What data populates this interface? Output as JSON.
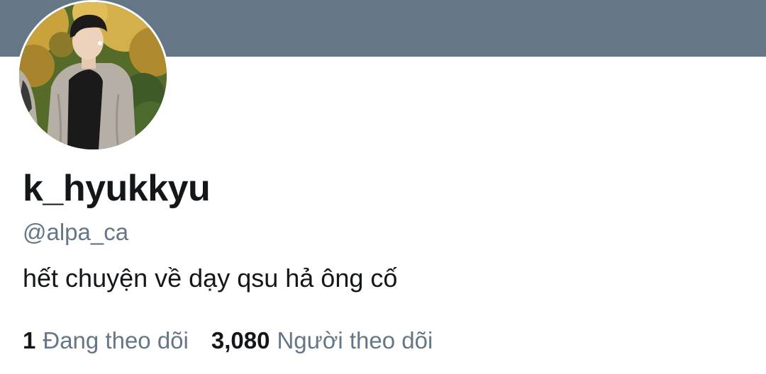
{
  "profile": {
    "display_name": "k_hyukkyu",
    "handle": "@alpa_ca",
    "bio": "hết chuyện về dạy qsu hả ông cố",
    "avatar_icon": "profile-photo",
    "banner_color": "#657786"
  },
  "stats": {
    "following_count": "1",
    "following_label": "Đang theo dõi",
    "followers_count": "3,080",
    "followers_label": "Người theo dõi"
  }
}
